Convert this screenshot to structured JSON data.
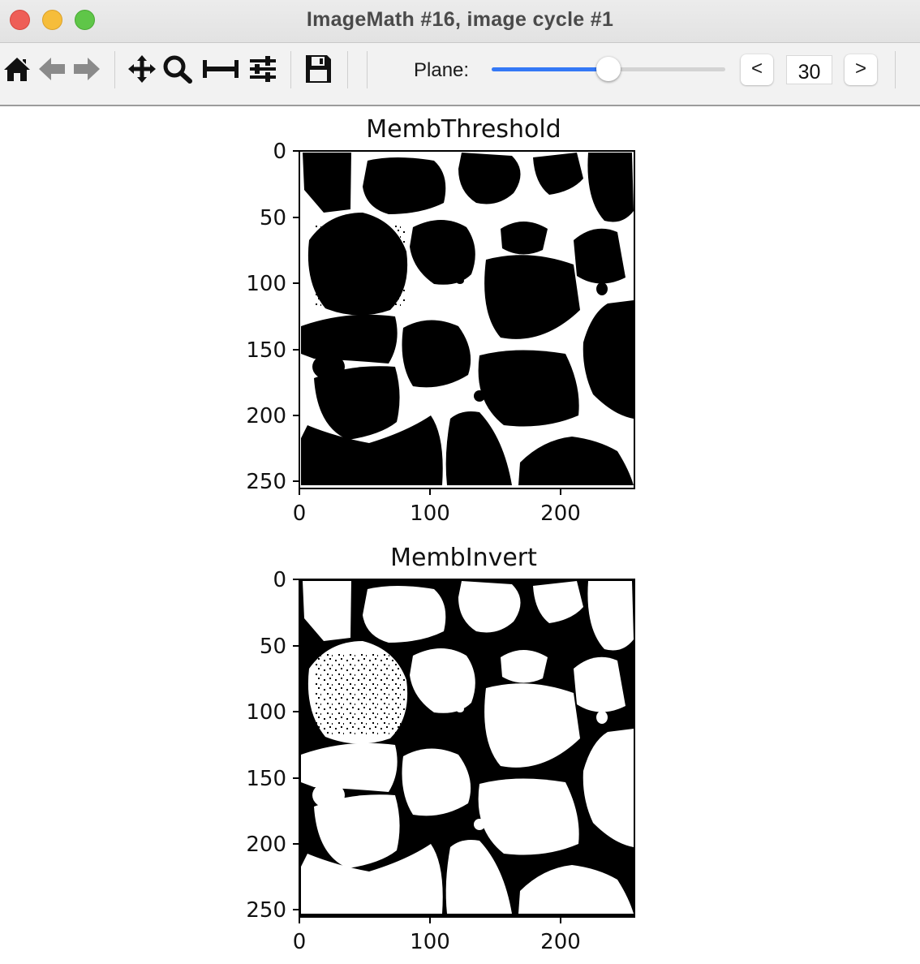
{
  "window": {
    "title": "ImageMath #16, image cycle #1"
  },
  "toolbar": {
    "tools": [
      "home-icon",
      "back-icon",
      "forward-icon",
      "pan-icon",
      "zoom-icon",
      "subplots-icon",
      "configure-icon",
      "save-icon"
    ],
    "plane_label": "Plane:",
    "plane_value": "30",
    "plane_slider_fraction": 0.5,
    "prev_label": "<",
    "next_label": ">",
    "accent_color": "#3478f6"
  },
  "plots": [
    {
      "title": "MembThreshold",
      "y_ticks": [
        "0",
        "50",
        "100",
        "150",
        "200",
        "250"
      ],
      "x_ticks": [
        "0",
        "100",
        "200"
      ],
      "fg": "#ffffff",
      "bg": "#000000"
    },
    {
      "title": "MembInvert",
      "y_ticks": [
        "0",
        "50",
        "100",
        "150",
        "200",
        "250"
      ],
      "x_ticks": [
        "0",
        "100",
        "200"
      ],
      "fg": "#000000",
      "bg": "#ffffff"
    }
  ]
}
